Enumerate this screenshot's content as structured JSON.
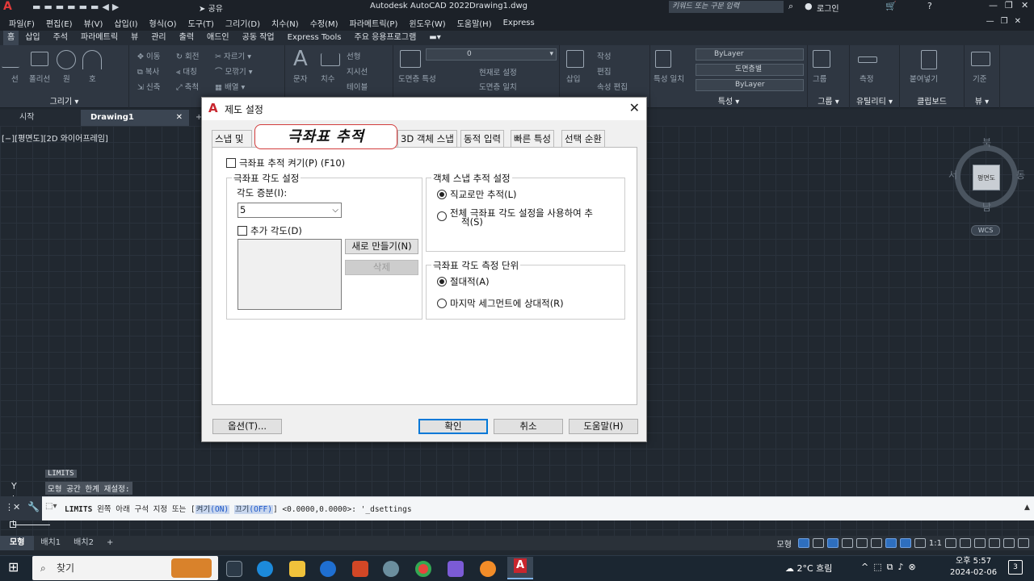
{
  "app": {
    "title": "Autodesk AutoCAD 2022",
    "document": "Drawing1.dwg",
    "share_label": "공유",
    "search_placeholder": "키워드 또는 구문 입력",
    "login_label": "로그인"
  },
  "menu": [
    "파일(F)",
    "편집(E)",
    "뷰(V)",
    "삽입(I)",
    "형식(O)",
    "도구(T)",
    "그리기(D)",
    "치수(N)",
    "수정(M)",
    "파라메트릭(P)",
    "윈도우(W)",
    "도움말(H)",
    "Express"
  ],
  "ribbon_tabs": [
    "홈",
    "삽입",
    "주석",
    "파라메트릭",
    "뷰",
    "관리",
    "출력",
    "애드인",
    "공동 작업",
    "Express Tools",
    "주요 응용프로그램"
  ],
  "ribbon": {
    "draw": {
      "title": "그리기",
      "tools": [
        "선",
        "폴리선",
        "원",
        "호"
      ]
    },
    "modify": {
      "title": "수정",
      "tools": [
        "이동",
        "회전",
        "자르기",
        "복사",
        "대칭",
        "모깎기",
        "신축",
        "축척",
        "배열"
      ]
    },
    "annotation": {
      "tools": [
        "문자",
        "치수",
        "선형",
        "지시선",
        "테이블"
      ]
    },
    "layers": {
      "tools": [
        "도면층 특성",
        "현재로 설정",
        "도면층 일치"
      ],
      "current": "0"
    },
    "block": {
      "tools": [
        "삽입",
        "작성",
        "편집",
        "속성 편집"
      ]
    },
    "properties": {
      "title": "특성",
      "tools": [
        "특성 일치"
      ],
      "values": [
        "ByLayer",
        "도면층별",
        "ByLayer"
      ]
    },
    "groups": {
      "title": "그룹",
      "tools": [
        "그룹"
      ]
    },
    "utilities": {
      "title": "유틸리티",
      "tools": [
        "측정"
      ]
    },
    "clipboard": {
      "title": "클립보드",
      "tools": [
        "붙여넣기"
      ]
    },
    "view": {
      "title": "뷰",
      "tools": [
        "기준"
      ]
    }
  },
  "doc_tabs": {
    "start": "시작",
    "drawing": "Drawing1"
  },
  "viewport_label": "[−][평면도][2D 와이어프레임]",
  "viewcube": {
    "n": "북",
    "s": "남",
    "e": "동",
    "w": "서",
    "face": "평면도",
    "wcs": "WCS"
  },
  "command": {
    "history": [
      "LIMITS",
      "모형 공간 한계 재설정:"
    ],
    "prefix": "LIMITS",
    "text": "왼쪽 아래 구석 지정 또는 [",
    "opt1": "켜기",
    "opt1_key": "(ON)",
    "opt2": "끄기",
    "opt2_key": "(OFF)",
    "suffix": "] <0.0000,0.0000>: '_dsettings"
  },
  "layout_tabs": [
    "모형",
    "배치1",
    "배치2"
  ],
  "status": {
    "model": "모형",
    "scale": "1:1"
  },
  "taskbar": {
    "search": "찾기",
    "weather": "2°C 흐림",
    "time": "오후 5:57",
    "date": "2024-02-06",
    "badge": "3"
  },
  "dialog": {
    "title": "제도 설정",
    "tabs": [
      "스냅 및",
      "극좌표 추적",
      "3D 객체 스냅",
      "동적 입력",
      "빠른 특성",
      "선택 순환"
    ],
    "polar_on": {
      "label": "극좌표 추적 켜기(P) (F10)",
      "checked": false
    },
    "angle_group": "극좌표 각도 설정",
    "increment_label": "각도 증분(I):",
    "increment_value": "5",
    "additional_label": "추가 각도(D)",
    "new_button": "새로 만들기(N)",
    "delete_button": "삭제",
    "snap_group": "객체 스냅 추적 설정",
    "ortho_only": "직교로만 추적(L)",
    "all_polar_line1": "전체 극좌표 각도 설정을 사용하여 추",
    "all_polar_line2": "적(S)",
    "measure_group": "극좌표 각도 측정 단위",
    "absolute": "절대적(A)",
    "relative": "마지막 세그먼트에 상대적(R)",
    "options_button": "옵션(T)...",
    "ok_button": "확인",
    "cancel_button": "취소",
    "help_button": "도움말(H)"
  }
}
